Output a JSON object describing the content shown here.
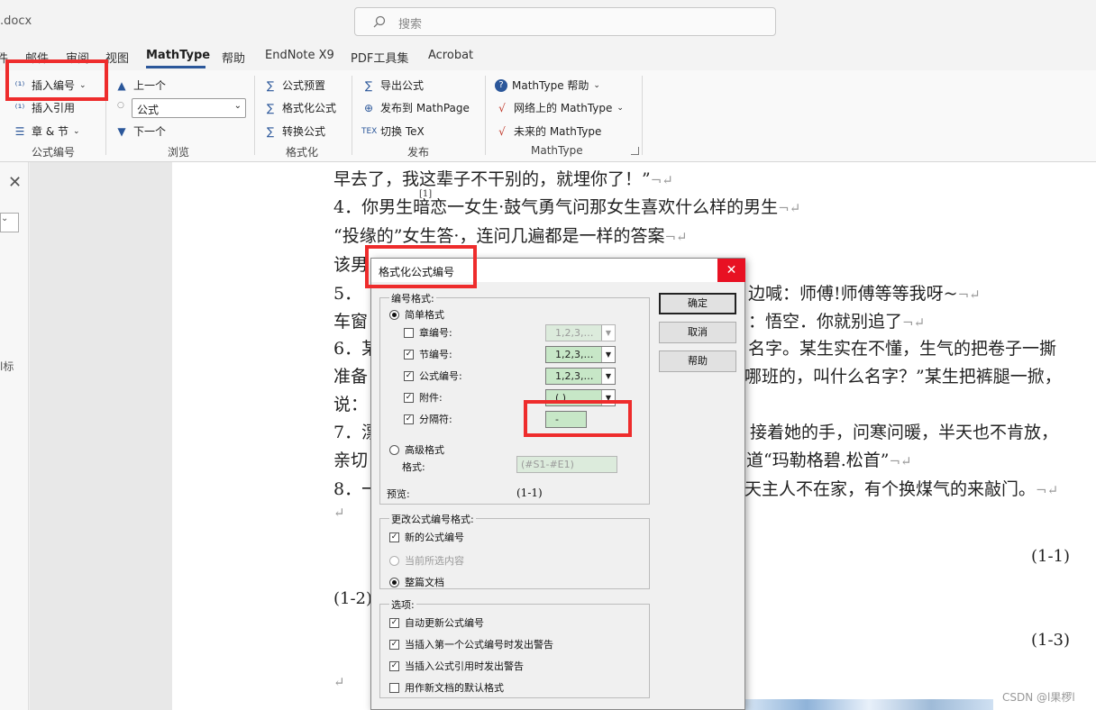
{
  "window": {
    "doc_title": ".docx",
    "search_placeholder": "搜索"
  },
  "tabs": [
    "件",
    "邮件",
    "审阅",
    "视图",
    "MathType",
    "帮助",
    "EndNote X9",
    "PDF工具集",
    "Acrobat"
  ],
  "ribbon": {
    "formula_numbering": {
      "insert_number": "插入编号",
      "insert_reference": "插入引用",
      "chapter_section": "章 & 节",
      "group_label": "公式编号"
    },
    "browse": {
      "prev": "上一个",
      "select_value": "公式",
      "next": "下一个",
      "group_label": "浏览"
    },
    "format": {
      "preset": "公式预置",
      "format_formula": "格式化公式",
      "convert": "转换公式",
      "group_label": "格式化"
    },
    "publish": {
      "export": "导出公式",
      "publish_mathpage": "发布到 MathPage",
      "toggle_tex": "切换 TeX",
      "group_label": "发布"
    },
    "mathtype": {
      "help": "MathType 帮助",
      "online": "网络上的 MathType",
      "future": "未来的 MathType",
      "group_label": "MathType"
    }
  },
  "left_pane": {
    "fragment": "l标"
  },
  "document": {
    "lines": [
      "早去了，我这辈子不干别的，就埋你了！”",
      "4．你男生暗恋一女生·鼓气勇气问那女生喜欢什么样的男生",
      "“投缘的”女生答·，连问几遍都是一样的答案",
      "该男",
      "5．",
      "车窗",
      "6．某",
      "准备",
      "说：",
      "7．漂",
      "亲切",
      "8．一"
    ],
    "right_fragments": {
      "line5": "边喊：师傅!师傅等等我呀~",
      "line6": "：悟空．你就别追了",
      "line7": "名字。某生实在不懂，生气的把卷子一撕",
      "line8": "哪班的，叫什么名字？”某生把裤腿一掀，",
      "line10": "接着她的手，问寒问暖，半天也不肯放，",
      "line11": "道“玛勒格碧.松首”",
      "line12": "天主人不在家，有个换煤气的来敲门。"
    },
    "footnote_ref": "[1]",
    "equation_numbers": [
      "(1-1)",
      "(1-2)",
      "(1-3)"
    ],
    "watermark": "CSDN @l果椤l"
  },
  "dialog": {
    "title": "格式化公式编号",
    "numbering_format_group": "编号格式:",
    "simple_format": "简单格式",
    "chapter_number": "章编号:",
    "section_number": "节编号:",
    "equation_number": "公式编号:",
    "enclosure": "附件:",
    "separator": "分隔符:",
    "chapter_value": "1,2,3,…",
    "section_value": "1,2,3,…",
    "equation_value": "1,2,3,…",
    "enclosure_value": "( )",
    "separator_value": "-",
    "advanced_format": "高级格式",
    "format_label": "格式:",
    "format_value": "(#S1-#E1)",
    "preview_label": "预览:",
    "preview_value": "(1-1)",
    "change_group": "更改公式编号格式:",
    "new_numbers": "新的公式编号",
    "current_selection": "当前所选内容",
    "whole_document": "整篇文档",
    "options_group": "选项:",
    "opt_auto_update": "自动更新公式编号",
    "opt_warn_first": "当插入第一个公式编号时发出警告",
    "opt_warn_ref": "当插入公式引用时发出警告",
    "opt_default": "用作新文档的默认格式",
    "ok": "确定",
    "cancel": "取消",
    "help": "帮助"
  },
  "colors": {
    "highlight": "#ee2c2c",
    "accent": "#2b579a",
    "dialog_field": "#c7e7c7"
  }
}
